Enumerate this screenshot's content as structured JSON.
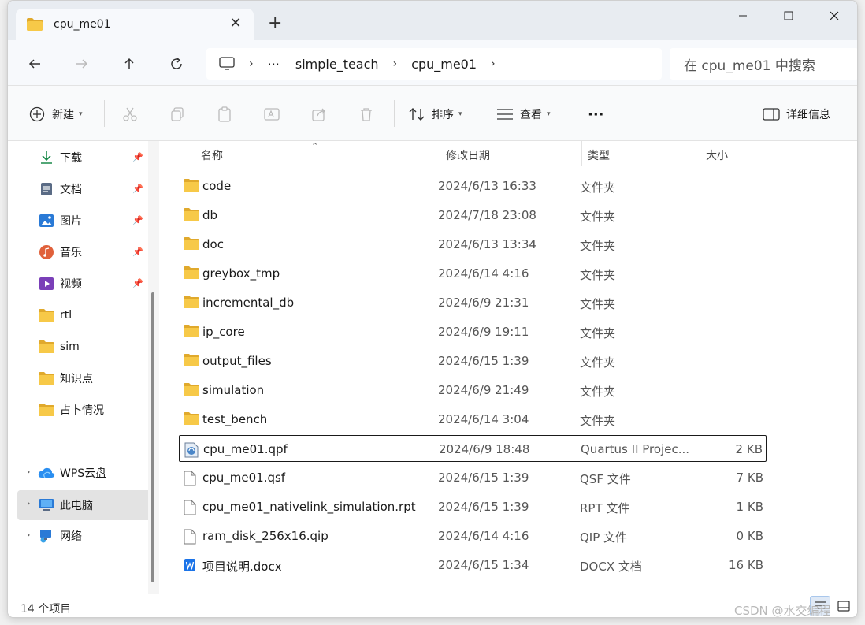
{
  "window": {
    "tab_title": "cpu_me01",
    "new_tab": "+"
  },
  "nav": {
    "breadcrumb": [
      "simple_teach",
      "cpu_me01"
    ],
    "more": "···",
    "search_placeholder": "在 cpu_me01 中搜索"
  },
  "toolbar": {
    "new_label": "新建",
    "sort_label": "排序",
    "view_label": "查看",
    "more_label": "···",
    "details_label": "详细信息"
  },
  "sidebar": {
    "quick": [
      {
        "label": "下载",
        "icon": "download-icon",
        "pinned": true
      },
      {
        "label": "文档",
        "icon": "documents-icon",
        "pinned": true
      },
      {
        "label": "图片",
        "icon": "pictures-icon",
        "pinned": true
      },
      {
        "label": "音乐",
        "icon": "music-icon",
        "pinned": true
      },
      {
        "label": "视频",
        "icon": "videos-icon",
        "pinned": true
      },
      {
        "label": "rtl",
        "icon": "folder-icon",
        "pinned": false
      },
      {
        "label": "sim",
        "icon": "folder-icon",
        "pinned": false
      },
      {
        "label": "知识点",
        "icon": "folder-icon",
        "pinned": false
      },
      {
        "label": "占卜情况",
        "icon": "folder-icon",
        "pinned": false
      }
    ],
    "roots": [
      {
        "label": "WPS云盘",
        "icon": "cloud-icon",
        "selected": false
      },
      {
        "label": "此电脑",
        "icon": "computer-icon",
        "selected": true
      },
      {
        "label": "网络",
        "icon": "network-icon",
        "selected": false
      }
    ]
  },
  "columns": {
    "name": "名称",
    "date": "修改日期",
    "type": "类型",
    "size": "大小"
  },
  "files": [
    {
      "name": "code",
      "date": "2024/6/13 16:33",
      "type": "文件夹",
      "size": "",
      "kind": "folder"
    },
    {
      "name": "db",
      "date": "2024/7/18 23:08",
      "type": "文件夹",
      "size": "",
      "kind": "folder"
    },
    {
      "name": "doc",
      "date": "2024/6/13 13:34",
      "type": "文件夹",
      "size": "",
      "kind": "folder"
    },
    {
      "name": "greybox_tmp",
      "date": "2024/6/14 4:16",
      "type": "文件夹",
      "size": "",
      "kind": "folder"
    },
    {
      "name": "incremental_db",
      "date": "2024/6/9 21:31",
      "type": "文件夹",
      "size": "",
      "kind": "folder"
    },
    {
      "name": "ip_core",
      "date": "2024/6/9 19:11",
      "type": "文件夹",
      "size": "",
      "kind": "folder"
    },
    {
      "name": "output_files",
      "date": "2024/6/15 1:39",
      "type": "文件夹",
      "size": "",
      "kind": "folder"
    },
    {
      "name": "simulation",
      "date": "2024/6/9 21:49",
      "type": "文件夹",
      "size": "",
      "kind": "folder"
    },
    {
      "name": "test_bench",
      "date": "2024/6/14 3:04",
      "type": "文件夹",
      "size": "",
      "kind": "folder"
    },
    {
      "name": "cpu_me01.qpf",
      "date": "2024/6/9 18:48",
      "type": "Quartus II Projec...",
      "size": "2 KB",
      "kind": "qpf",
      "selected": true
    },
    {
      "name": "cpu_me01.qsf",
      "date": "2024/6/15 1:39",
      "type": "QSF 文件",
      "size": "7 KB",
      "kind": "file"
    },
    {
      "name": "cpu_me01_nativelink_simulation.rpt",
      "date": "2024/6/15 1:39",
      "type": "RPT 文件",
      "size": "1 KB",
      "kind": "file"
    },
    {
      "name": "ram_disk_256x16.qip",
      "date": "2024/6/14 4:16",
      "type": "QIP 文件",
      "size": "0 KB",
      "kind": "file"
    },
    {
      "name": "项目说明.docx",
      "date": "2024/6/15 1:34",
      "type": "DOCX 文档",
      "size": "16 KB",
      "kind": "docx"
    }
  ],
  "status": {
    "count": "14 个项目"
  },
  "watermark": "CSDN @水交编程",
  "colors": {
    "folder": "#f7c948",
    "folder_dark": "#e0a92c",
    "accent": "#1a73e8",
    "selected_bg": "#e3e3e3"
  }
}
